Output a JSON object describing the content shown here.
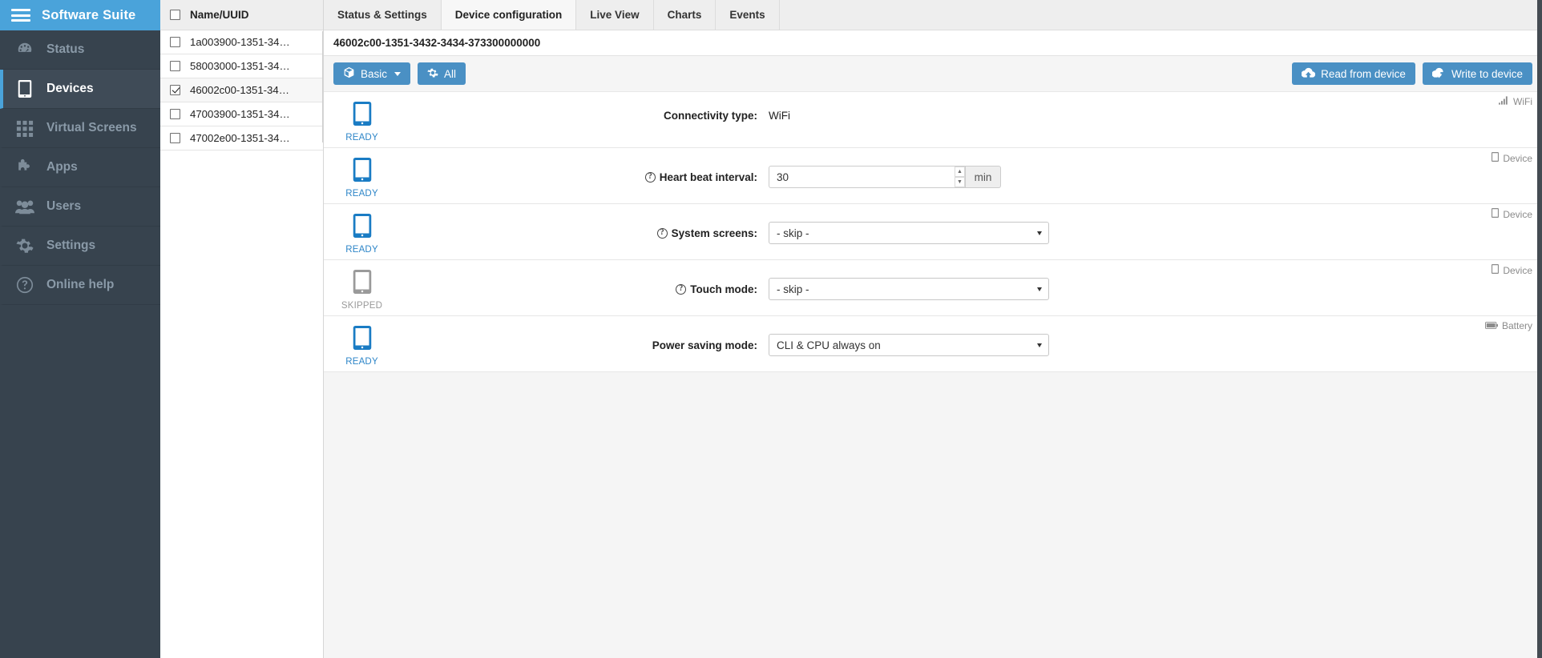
{
  "brand": {
    "title": "Software Suite",
    "icon": "hamburger-icon"
  },
  "sidebar": {
    "items": [
      {
        "label": "Status",
        "icon": "dashboard-icon",
        "active": false
      },
      {
        "label": "Devices",
        "icon": "tablet-icon",
        "active": true
      },
      {
        "label": "Virtual Screens",
        "icon": "grid-icon",
        "active": false
      },
      {
        "label": "Apps",
        "icon": "puzzle-icon",
        "active": false
      },
      {
        "label": "Users",
        "icon": "users-icon",
        "active": false
      },
      {
        "label": "Settings",
        "icon": "gear-icon",
        "active": false
      },
      {
        "label": "Online help",
        "icon": "question-circle-icon",
        "active": false
      }
    ]
  },
  "device_list": {
    "header_label": "Name/UUID",
    "header_checked": false,
    "rows": [
      {
        "label": "1a003900-1351-34…",
        "checked": false,
        "selected": false
      },
      {
        "label": "58003000-1351-34…",
        "checked": false,
        "selected": false
      },
      {
        "label": "46002c00-1351-34…",
        "checked": true,
        "selected": true
      },
      {
        "label": "47003900-1351-34…",
        "checked": false,
        "selected": false
      },
      {
        "label": "47002e00-1351-34…",
        "checked": false,
        "selected": false
      }
    ]
  },
  "tabs": [
    {
      "label": "Status & Settings",
      "active": false
    },
    {
      "label": "Device configuration",
      "active": true
    },
    {
      "label": "Live View",
      "active": false
    },
    {
      "label": "Charts",
      "active": false
    },
    {
      "label": "Events",
      "active": false
    }
  ],
  "selected_uuid": "46002c00-1351-3432-3434-373300000000",
  "toolbar": {
    "basic_label": "Basic",
    "basic_icon": "cube-icon",
    "all_label": "All",
    "all_icon": "gear-icon",
    "read_label": "Read from device",
    "read_icon": "cloud-upload-icon",
    "write_label": "Write to device",
    "write_icon": "cloud-download-icon"
  },
  "settings_rows": [
    {
      "state": "READY",
      "state_kind": "ready",
      "label": "Connectivity type:",
      "has_help": false,
      "control": "text",
      "value": "WiFi",
      "badge_label": "WiFi",
      "badge_icon": "signal-bars-icon"
    },
    {
      "state": "READY",
      "state_kind": "ready",
      "label": "Heart beat interval:",
      "has_help": true,
      "control": "spinner",
      "value": "30",
      "unit": "min",
      "badge_label": "Device",
      "badge_icon": "tablet-icon"
    },
    {
      "state": "READY",
      "state_kind": "ready",
      "label": "System screens:",
      "has_help": true,
      "control": "select",
      "value": "- skip -",
      "badge_label": "Device",
      "badge_icon": "tablet-icon"
    },
    {
      "state": "SKIPPED",
      "state_kind": "skipped",
      "label": "Touch mode:",
      "has_help": true,
      "control": "select",
      "value": "- skip -",
      "badge_label": "Device",
      "badge_icon": "tablet-icon"
    },
    {
      "state": "READY",
      "state_kind": "ready",
      "label": "Power saving mode:",
      "has_help": false,
      "control": "select",
      "value": "CLI & CPU always on",
      "badge_label": "Battery",
      "badge_icon": "battery-icon"
    }
  ],
  "colors": {
    "brand_blue": "#4aa3da",
    "sidebar_dark": "#37434e",
    "button_blue": "#4a90c4",
    "ready_blue": "#2e86c8",
    "skipped_gray": "#9a9a9a"
  }
}
